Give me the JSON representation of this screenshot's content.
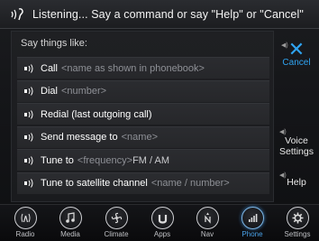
{
  "status": {
    "text": "Listening... Say a command or say \"Help\" or \"Cancel\""
  },
  "panel": {
    "heading": "Say things like:",
    "rows": [
      {
        "cmd": "Call",
        "arg": "<name as shown in phonebook>",
        "suffix": ""
      },
      {
        "cmd": "Dial",
        "arg": "<number>",
        "suffix": ""
      },
      {
        "cmd": "Redial (last outgoing call)",
        "arg": "",
        "suffix": ""
      },
      {
        "cmd": "Send message to",
        "arg": "<name>",
        "suffix": ""
      },
      {
        "cmd": "Tune to",
        "arg": "<frequency>",
        "suffix": "FM / AM"
      },
      {
        "cmd": "Tune to satellite channel",
        "arg": "<name / number>",
        "suffix": ""
      }
    ]
  },
  "side": {
    "cancel_label": "Cancel",
    "voice_settings_line1": "Voice",
    "voice_settings_line2": "Settings",
    "help_label": "Help"
  },
  "nav": {
    "items": [
      {
        "label": "Radio",
        "icon": "radio-icon"
      },
      {
        "label": "Media",
        "icon": "media-icon"
      },
      {
        "label": "Climate",
        "icon": "climate-icon"
      },
      {
        "label": "Apps",
        "icon": "apps-icon"
      },
      {
        "label": "Nav",
        "icon": "nav-icon"
      },
      {
        "label": "Phone",
        "icon": "phone-icon",
        "active": true
      },
      {
        "label": "Settings",
        "icon": "settings-icon"
      }
    ]
  },
  "colors": {
    "accent": "#2fa3f0",
    "argument_text": "#8e9096"
  }
}
